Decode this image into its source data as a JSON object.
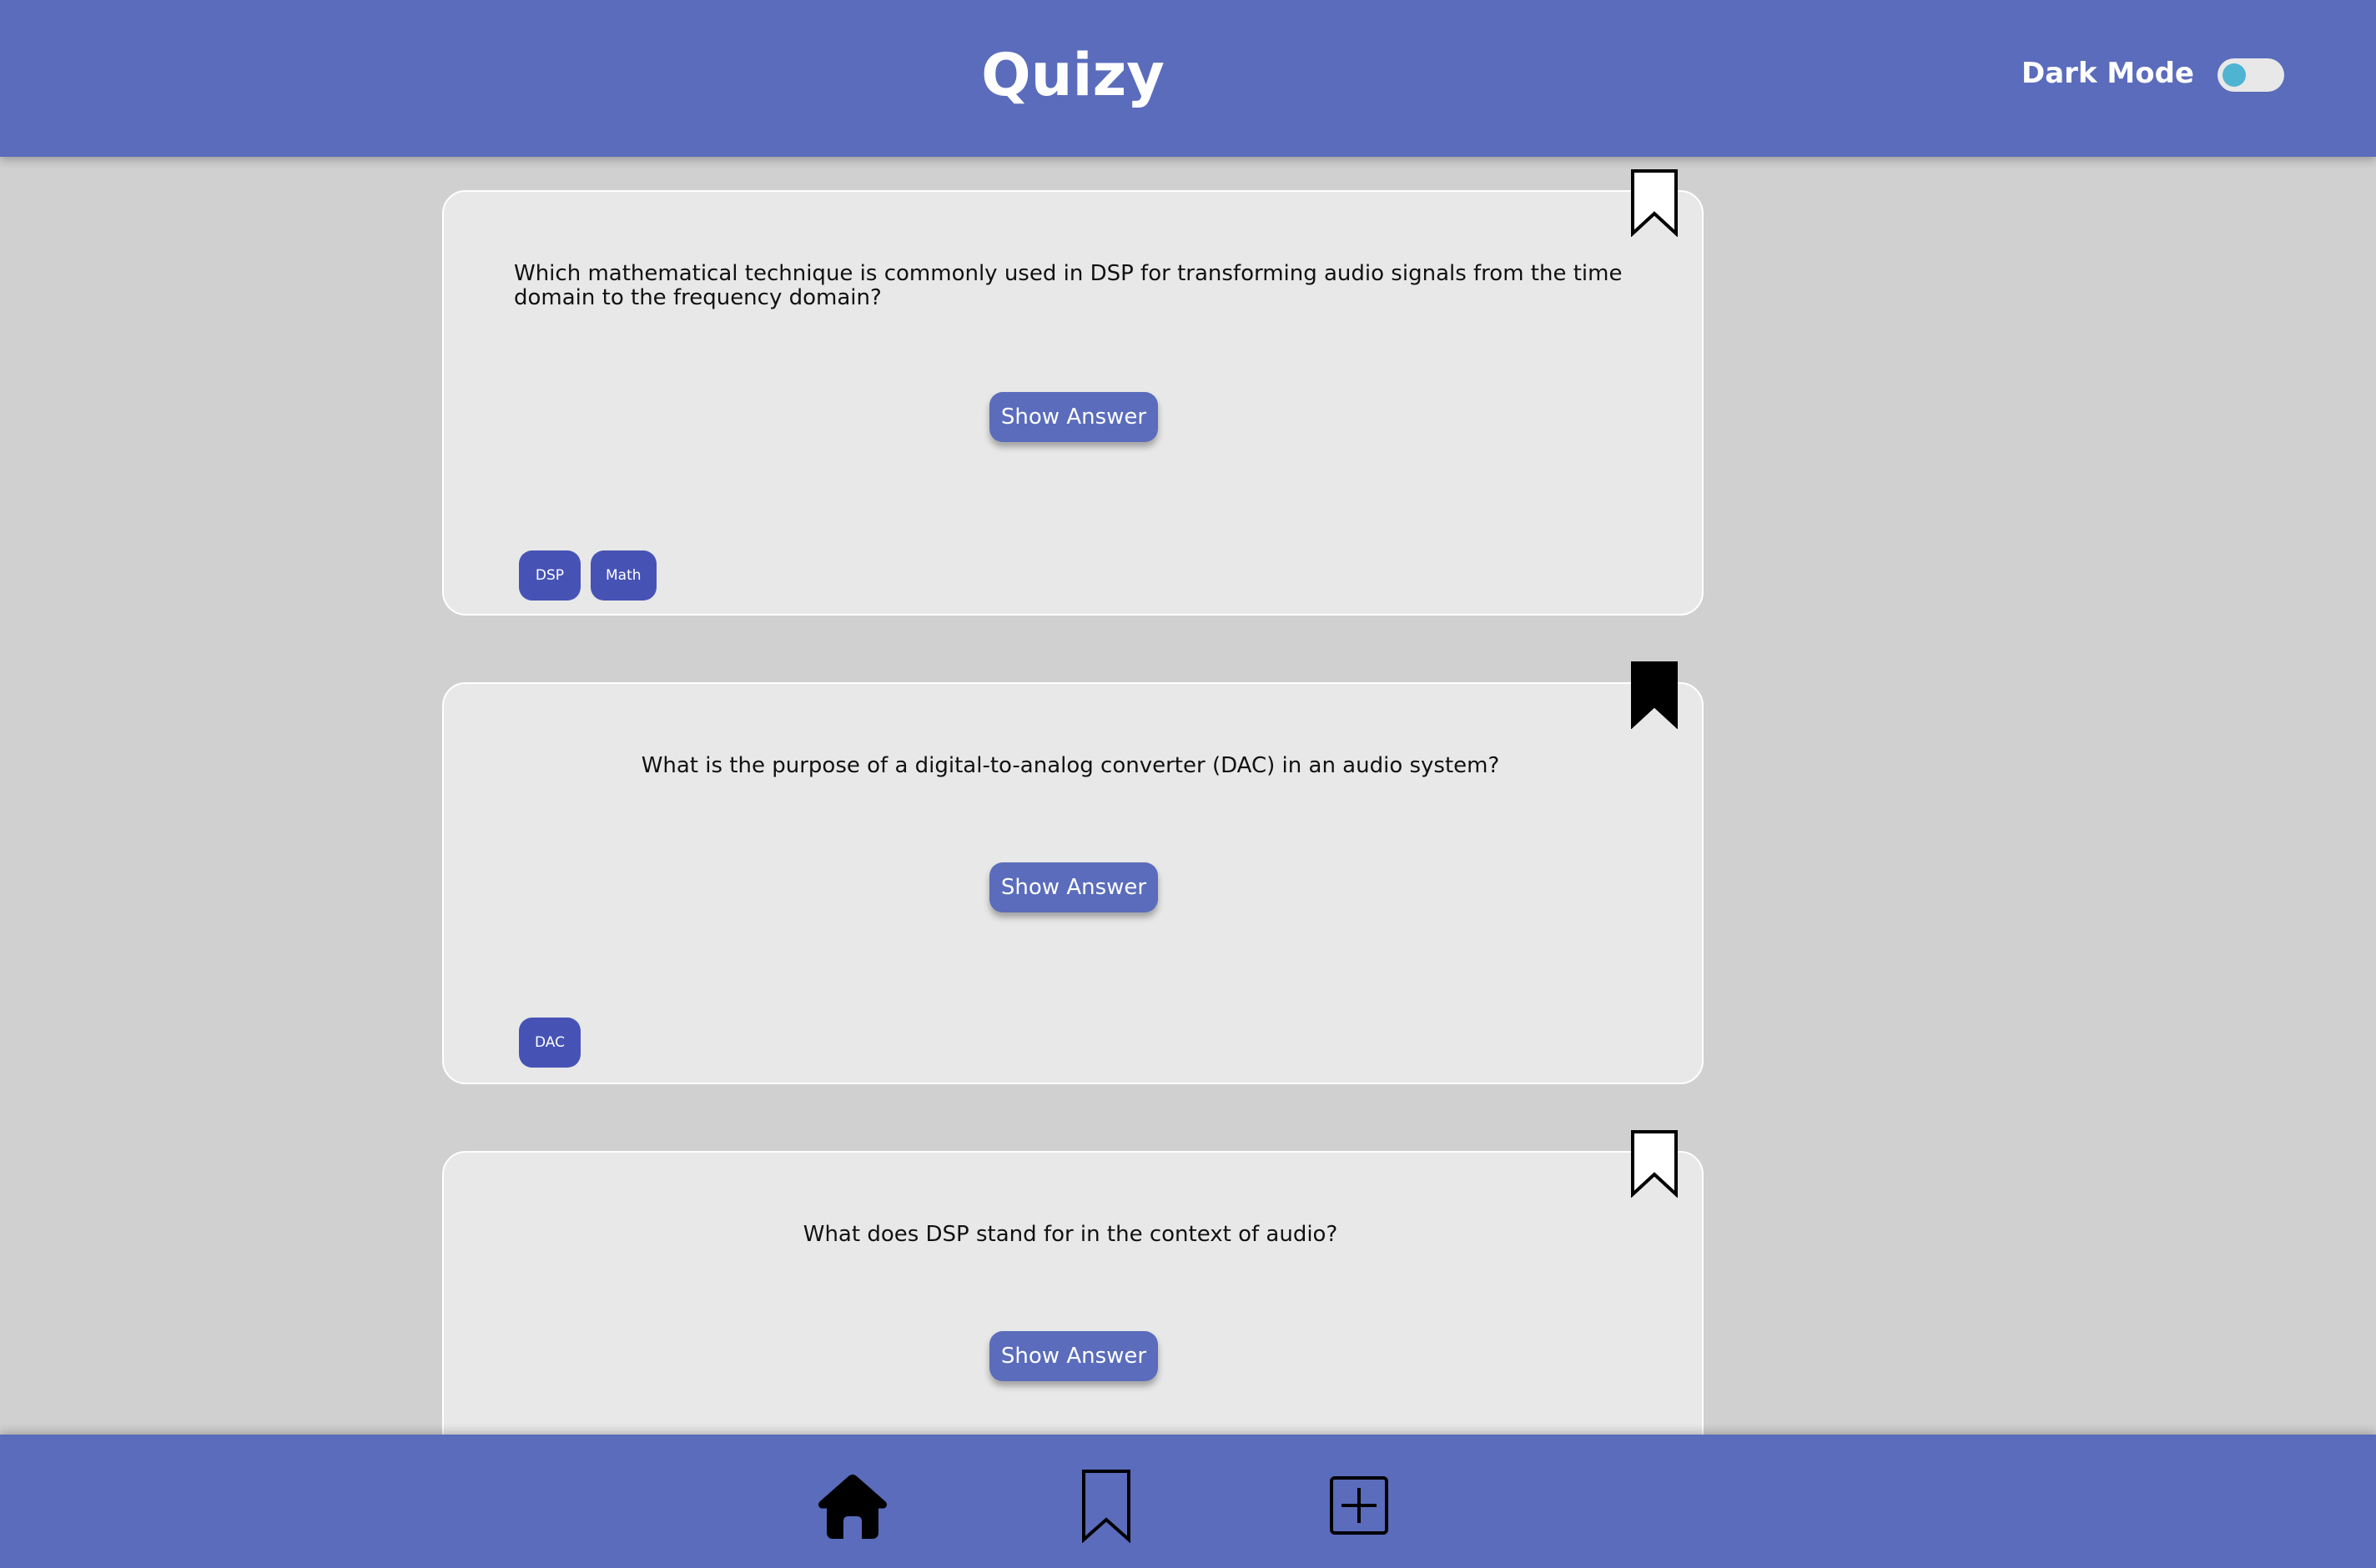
{
  "header": {
    "title": "Quizy",
    "dark_mode_label": "Dark Mode",
    "dark_mode_on": false
  },
  "cards": [
    {
      "question": "Which mathematical technique is commonly used in DSP for transforming audio signals from the time domain to the frequency domain?",
      "button_label": "Show Answer",
      "bookmarked": false,
      "tags": [
        "DSP",
        "Math"
      ]
    },
    {
      "question": "What is the purpose of a digital-to-analog converter (DAC) in an audio system?",
      "button_label": "Show Answer",
      "bookmarked": true,
      "tags": [
        "DAC"
      ]
    },
    {
      "question": "What does DSP stand for in the context of audio?",
      "button_label": "Show Answer",
      "bookmarked": false,
      "tags": []
    }
  ],
  "bottom_nav": {
    "items": [
      {
        "icon": "home-icon"
      },
      {
        "icon": "bookmark-icon"
      },
      {
        "icon": "plus-square-icon"
      }
    ]
  },
  "colors": {
    "primary": "#5a6cbb",
    "tag": "#4653b5",
    "background": "#d0d0d0",
    "card": "#e8e8e8",
    "toggle_knob": "#4fb4d2"
  }
}
